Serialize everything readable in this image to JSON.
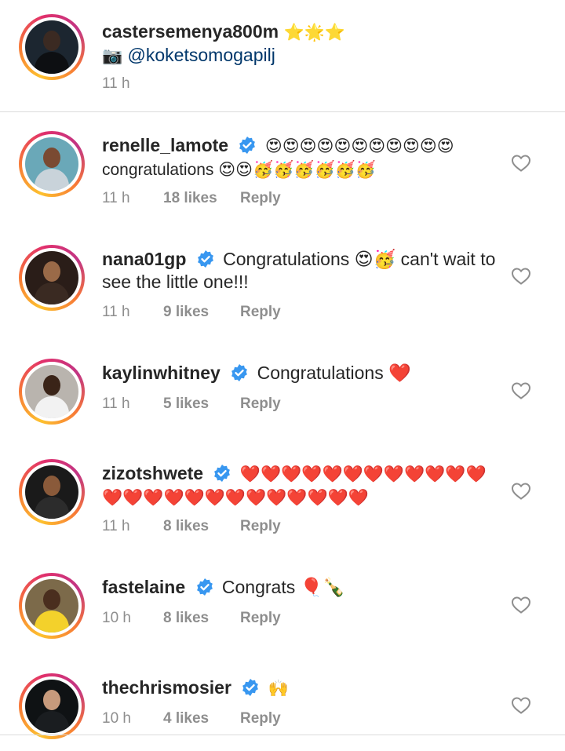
{
  "caption": {
    "username": "castersemenya800m",
    "title_emojis": "⭐🌟⭐",
    "camera_emoji": "📷",
    "mention": "@koketsomogapilj",
    "time": "11 h"
  },
  "comments": [
    {
      "username": "renelle_lamote",
      "text": "😍😍😍😍😍😍😍😍😍😍😍 congratulations 😍😍🥳🥳🥳🥳🥳🥳",
      "time": "11 h",
      "likes": "18 likes",
      "reply": "Reply"
    },
    {
      "username": "nana01gp",
      "text": "Congratulations 😍🥳 can't wait to see the little one!!!",
      "time": "11 h",
      "likes": "9 likes",
      "reply": "Reply"
    },
    {
      "username": "kaylinwhitney",
      "text": "Congratulations ❤️",
      "time": "11 h",
      "likes": "5 likes",
      "reply": "Reply"
    },
    {
      "username": "zizotshwete",
      "text": "❤️❤️❤️❤️❤️❤️❤️❤️❤️❤️❤️❤️❤️❤️❤️❤️❤️❤️❤️❤️❤️❤️❤️❤️❤️",
      "time": "11 h",
      "likes": "8 likes",
      "reply": "Reply"
    },
    {
      "username": "fastelaine",
      "text": "Congrats 🎈🍾",
      "time": "10 h",
      "likes": "8 likes",
      "reply": "Reply"
    },
    {
      "username": "thechrismosier",
      "text": "🙌",
      "time": "10 h",
      "likes": "4 likes",
      "reply": "Reply"
    }
  ],
  "icons": {
    "verified": "verified-badge-icon",
    "like": "heart-outline-icon"
  },
  "colors": {
    "verified_blue": "#3897f0",
    "meta_gray": "#8e8e8e",
    "mention_blue": "#00376b",
    "text": "#262626"
  }
}
